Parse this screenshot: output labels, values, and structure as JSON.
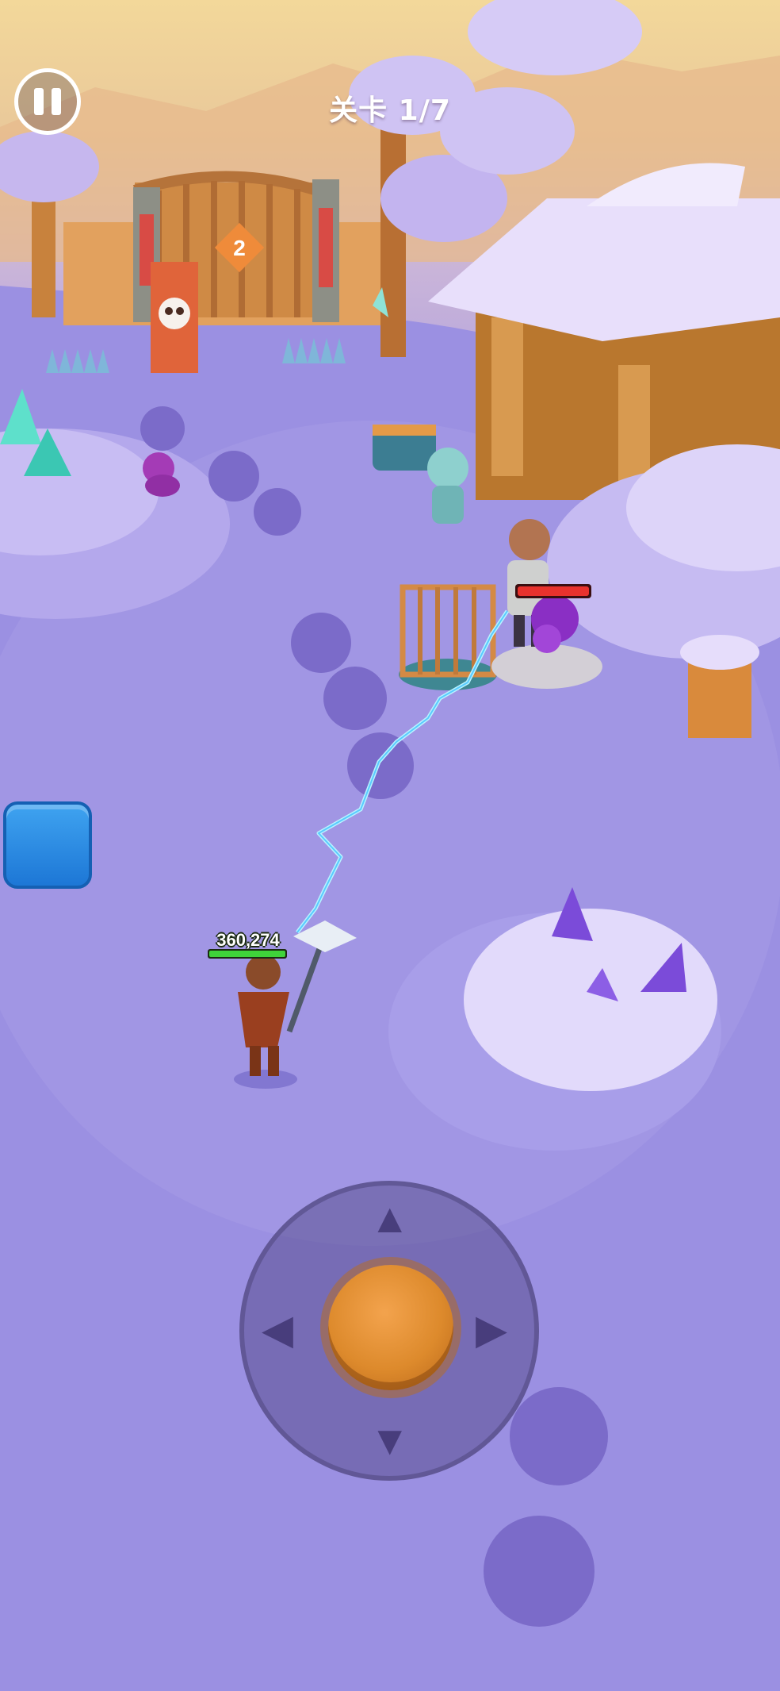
{
  "hud": {
    "level_label": "关卡 1/7",
    "player_hp_text": "360,274",
    "player_hp_fraction": 1.0,
    "enemy_hp_fraction": 1.0
  },
  "scene": {
    "gate_badge": "2"
  },
  "icons": {
    "pause": "pause-icon",
    "joystick_up": "arrow-up-icon",
    "joystick_down": "arrow-down-icon",
    "joystick_left": "arrow-left-icon",
    "joystick_right": "arrow-right-icon",
    "skull": "skull-icon"
  },
  "colors": {
    "ground": "#9a8fe0",
    "sky": "#f3d89a",
    "player_hp": "#3fd33a",
    "enemy_hp": "#e8322d",
    "joystick_knob": "#dd8a2c",
    "side_button": "#1d77d6"
  }
}
